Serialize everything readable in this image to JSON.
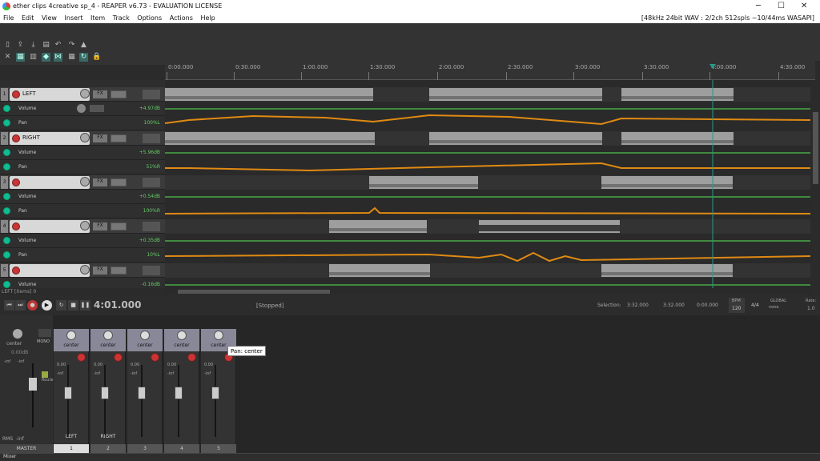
{
  "window": {
    "title": "ether clips 4creative sp_4 - REAPER v6.73 - EVALUATION LICENSE",
    "minimize": "─",
    "maximize": "☐",
    "close": "✕"
  },
  "menu": {
    "items": [
      "File",
      "Edit",
      "View",
      "Insert",
      "Item",
      "Track",
      "Options",
      "Actions",
      "Help"
    ],
    "audio_status": "[48kHz 24bit WAV : 2/2ch 512spls ~10/44ms WASAPI]"
  },
  "ruler": {
    "labels": [
      "0:00.000",
      "0:30.000",
      "1:00.000",
      "1:30.000",
      "2:00.000",
      "2:30.000",
      "3:00.000",
      "3:30.000",
      "4:00.000",
      "4:30.000"
    ]
  },
  "tracks": [
    {
      "num": "1",
      "name": "LEFT",
      "volume": "+4.97dB",
      "pan": "100%L",
      "pan_side": "left"
    },
    {
      "num": "2",
      "name": "RIGHT",
      "volume": "+5.96dB",
      "pan": "51%R",
      "pan_side": "right"
    },
    {
      "num": "3",
      "name": "",
      "volume": "+0.54dB",
      "pan": "100%R",
      "pan_side": "right"
    },
    {
      "num": "4",
      "name": "",
      "volume": "+0.35dB",
      "pan": "10%L",
      "pan_side": "left"
    },
    {
      "num": "5",
      "name": "",
      "volume": "-0.16dB",
      "pan": "",
      "pan_side": ""
    }
  ],
  "envelope_labels": {
    "volume": "Volume",
    "pan": "Pan"
  },
  "buttons": {
    "fx": "FX",
    "route": "Route",
    "mono": "MONO"
  },
  "status_left": "LEFT [items] 0",
  "transport": {
    "time": "4:01.000",
    "state": "[Stopped]",
    "selection_label": "Selection:",
    "selection_start": "3:32.000",
    "selection_end": "3:32.000",
    "selection_length": "0:00.000",
    "bpm_label": "BPM",
    "bpm": "120",
    "time_sig": "4/4",
    "global_label": "GLOBAL",
    "global_sub": "none",
    "rate_label": "Rate:",
    "rate": "1.0"
  },
  "master": {
    "label": "MASTER",
    "pan": "center",
    "vol": "0.00dB",
    "rms_label": "RMS",
    "rms_value": "-inf",
    "peak_left": "-inf",
    "peak_right": "-inf"
  },
  "mixer_strips": [
    {
      "num": "1",
      "name": "LEFT",
      "pan": "center",
      "vol": "0.00",
      "peak": "-inf",
      "selected": true
    },
    {
      "num": "2",
      "name": "RIGHT",
      "pan": "center",
      "vol": "0.00",
      "peak": "-inf",
      "selected": false
    },
    {
      "num": "3",
      "name": "",
      "pan": "center",
      "vol": "0.00",
      "peak": "-inf",
      "selected": false
    },
    {
      "num": "4",
      "name": "",
      "pan": "center",
      "vol": "0.00",
      "peak": "-inf",
      "selected": false
    },
    {
      "num": "5",
      "name": "",
      "pan": "center",
      "vol": "0.00",
      "peak": "-inf",
      "selected": false
    }
  ],
  "tooltip": "Pan: center",
  "mixer_tab": "Mixer",
  "colors": {
    "volume_env": "#3f8a3f",
    "pan_env": "#e08a12",
    "item_bg": "#9e9e9e",
    "playhead": "#2a9a8a"
  }
}
